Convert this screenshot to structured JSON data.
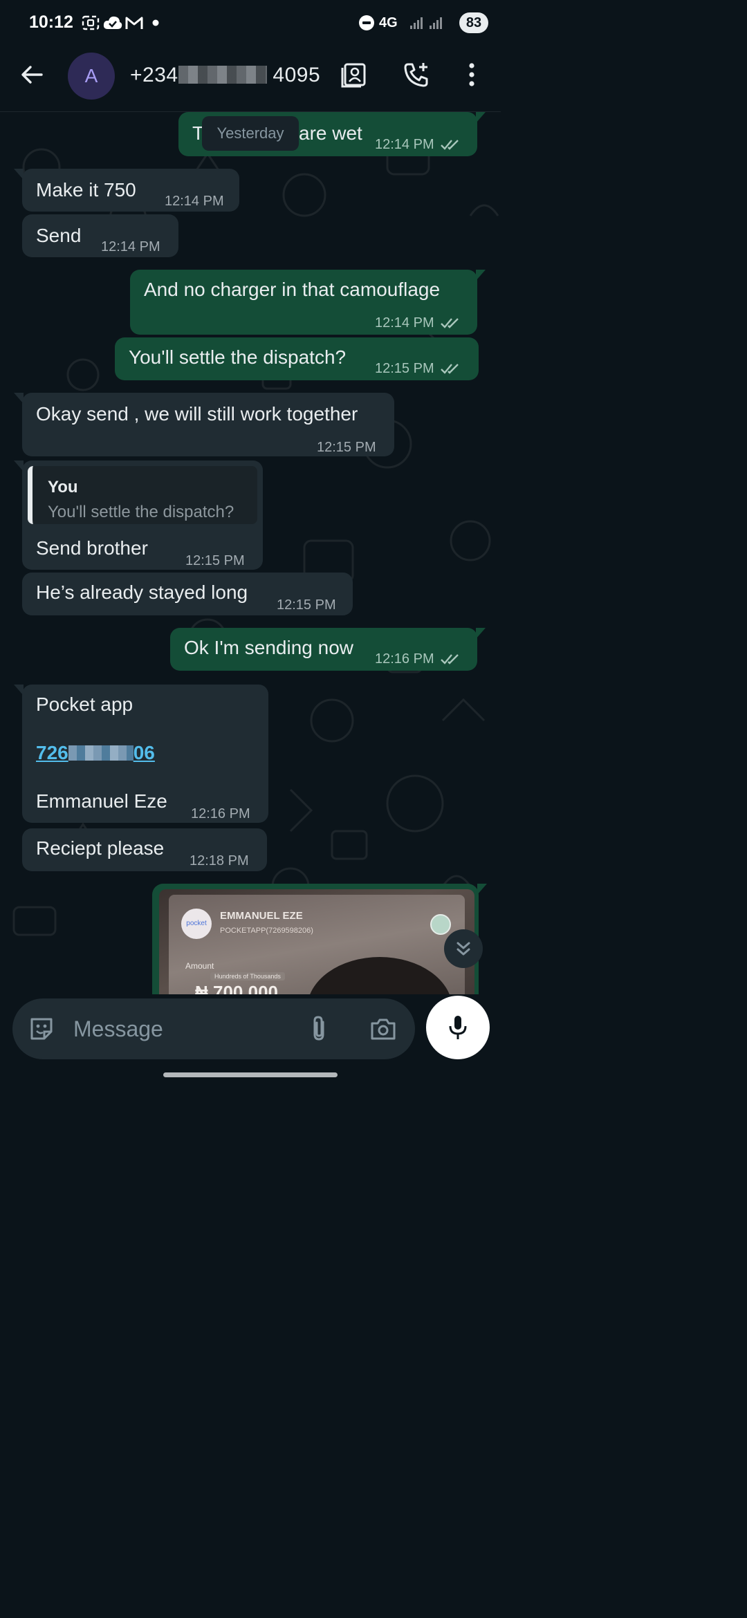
{
  "status_bar": {
    "time": "10:12",
    "battery": "83",
    "network": "4G"
  },
  "header": {
    "avatar_letter": "A",
    "contact_prefix": "+234",
    "contact_suffix": "4095"
  },
  "date_chip": "Yesterday",
  "messages": [
    {
      "dir": "out",
      "text_start": "T",
      "text_end": "are wet",
      "time": "12:14 PM"
    },
    {
      "dir": "in",
      "text": "Make it 750",
      "time": "12:14 PM"
    },
    {
      "dir": "in",
      "text": "Send",
      "time": "12:14 PM"
    },
    {
      "dir": "out",
      "text": "And no charger in that camouflage",
      "time": "12:14 PM"
    },
    {
      "dir": "out",
      "text": "You'll settle the dispatch?",
      "time": "12:15 PM"
    },
    {
      "dir": "in",
      "text": "Okay send , we will still work together",
      "time": "12:15 PM"
    },
    {
      "dir": "in",
      "quote_author": "You",
      "quote_text": "You'll settle the dispatch?",
      "text": "Send brother",
      "time": "12:15 PM"
    },
    {
      "dir": "in",
      "text": "He’s already stayed long",
      "time": "12:15 PM"
    },
    {
      "dir": "out",
      "text": "Ok I'm sending now",
      "time": "12:16 PM"
    },
    {
      "dir": "in",
      "line1": "Pocket app",
      "link_start": "726",
      "link_end": "06",
      "line3": "Emmanuel Eze",
      "time": "12:16 PM"
    },
    {
      "dir": "in",
      "text": "Reciept please",
      "time": "12:18 PM"
    }
  ],
  "receipt_image": {
    "logo": "pocket",
    "name": "EMMANUEL EZE",
    "account": "POCKETAPP(7269598206)",
    "amount_label": "Amount",
    "amount_hint": "Hundreds of Thousands",
    "amount": "₦ 700,000"
  },
  "composer": {
    "placeholder": "Message"
  },
  "colors": {
    "background": "#0b141a",
    "incoming_bubble": "#202c33",
    "outgoing_bubble": "#144d37",
    "link": "#53bdeb",
    "avatar_bg": "#2e2a56"
  }
}
